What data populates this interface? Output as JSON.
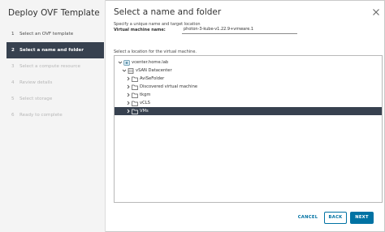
{
  "wizard": {
    "title": "Deploy OVF Template",
    "steps": [
      {
        "num": "1",
        "label": "Select an OVF template",
        "state": "done"
      },
      {
        "num": "2",
        "label": "Select a name and folder",
        "state": "active"
      },
      {
        "num": "3",
        "label": "Select a compute resource",
        "state": "disabled"
      },
      {
        "num": "4",
        "label": "Review details",
        "state": "disabled"
      },
      {
        "num": "5",
        "label": "Select storage",
        "state": "disabled"
      },
      {
        "num": "6",
        "label": "Ready to complete",
        "state": "disabled"
      }
    ]
  },
  "main": {
    "title": "Select a name and folder",
    "subtitle": "Specify a unique name and target location",
    "vm_name_label": "Virtual machine name:",
    "vm_name_value": "photon-3-kube-v1.22.9+vmware.1",
    "location_label": "Select a location for the virtual machine."
  },
  "tree": {
    "nodes": [
      {
        "label": "vcenter.home.lab",
        "icon": "vcenter-icon",
        "level": 0,
        "expanded": true,
        "selected": false
      },
      {
        "label": "vSAN Datacenter",
        "icon": "datacenter-icon",
        "level": 1,
        "expanded": true,
        "selected": false
      },
      {
        "label": "AviSeFolder",
        "icon": "folder-icon",
        "level": 2,
        "expanded": false,
        "selected": false
      },
      {
        "label": "Discovered virtual machine",
        "icon": "folder-icon",
        "level": 2,
        "expanded": false,
        "selected": false
      },
      {
        "label": "tkgm",
        "icon": "folder-icon",
        "level": 2,
        "expanded": false,
        "selected": false
      },
      {
        "label": "vCLS",
        "icon": "folder-icon",
        "level": 2,
        "expanded": false,
        "selected": false
      },
      {
        "label": "VMs",
        "icon": "folder-icon",
        "level": 2,
        "expanded": false,
        "selected": true
      }
    ]
  },
  "buttons": {
    "cancel": "CANCEL",
    "back": "BACK",
    "next": "NEXT"
  },
  "colors": {
    "accent": "#0072a3",
    "selected_bg": "#37414f",
    "sidebar_bg": "#f4f4f4"
  }
}
